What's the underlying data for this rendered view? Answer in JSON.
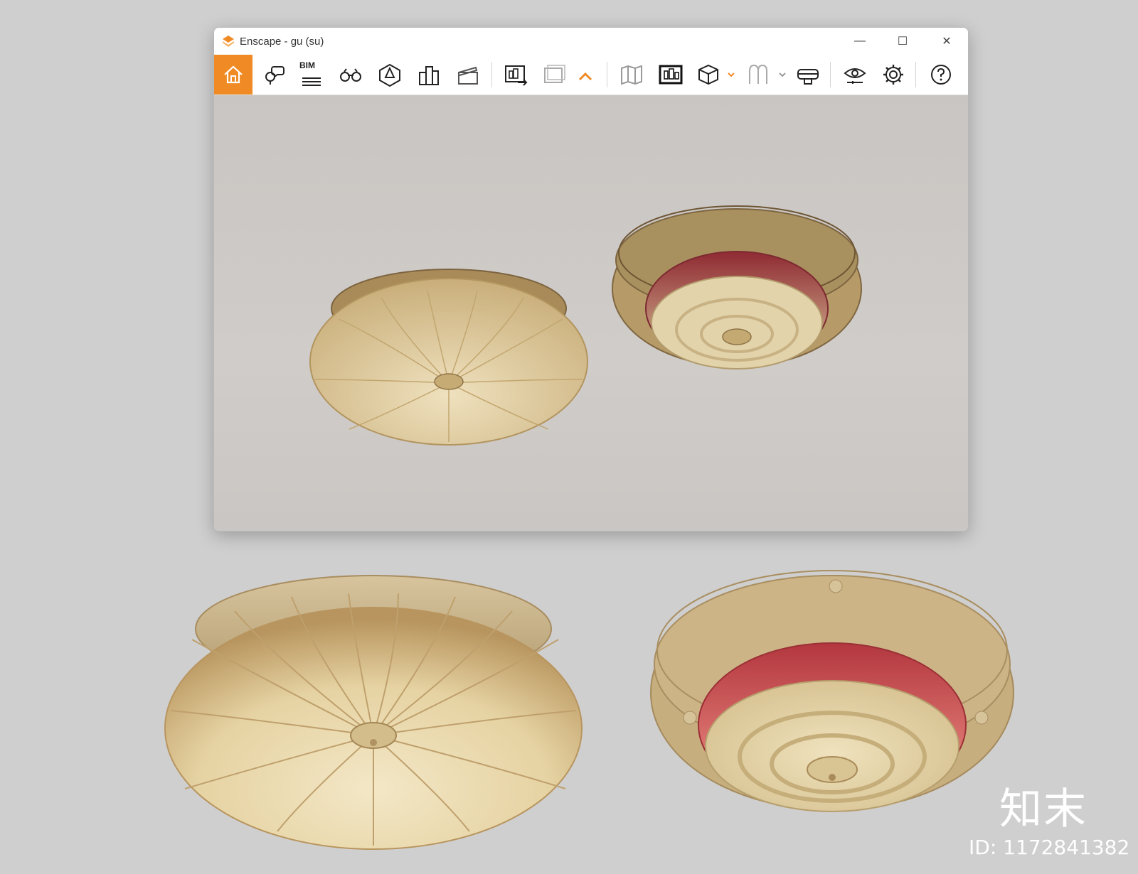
{
  "window": {
    "title": "Enscape - gu (su)"
  },
  "window_controls": {
    "minimize": "—",
    "maximize": "☐",
    "close": "✕"
  },
  "toolbar": {
    "accent_color": "#f08a24",
    "bim_label": "BIM",
    "buttons": [
      {
        "name": "home",
        "icon": "home-icon",
        "active": true
      },
      {
        "name": "location",
        "icon": "map-pin-chat-icon"
      },
      {
        "name": "bim",
        "icon": "bim-list-icon"
      },
      {
        "name": "binoculars",
        "icon": "binoculars-icon"
      },
      {
        "name": "asset-library",
        "icon": "cube-frame-icon"
      },
      {
        "name": "buildings",
        "icon": "buildings-icon"
      },
      {
        "name": "video-editor",
        "icon": "clapperboard-icon"
      },
      {
        "name": "export",
        "icon": "export-image-icon"
      },
      {
        "name": "batch-render",
        "icon": "batch-render-icon"
      },
      {
        "name": "collapse",
        "icon": "chevron-up-icon"
      },
      {
        "name": "map",
        "icon": "map-icon"
      },
      {
        "name": "screenshot",
        "icon": "render-window-icon"
      },
      {
        "name": "sketch-view",
        "icon": "cube-icon"
      },
      {
        "name": "material",
        "icon": "glass-icon"
      },
      {
        "name": "vr-headset",
        "icon": "vr-headset-icon"
      },
      {
        "name": "visual-settings",
        "icon": "eye-icon"
      },
      {
        "name": "settings",
        "icon": "gear-icon"
      },
      {
        "name": "help",
        "icon": "help-icon"
      }
    ]
  },
  "watermark": {
    "brand": "知末",
    "id": "ID: 1172841382"
  }
}
